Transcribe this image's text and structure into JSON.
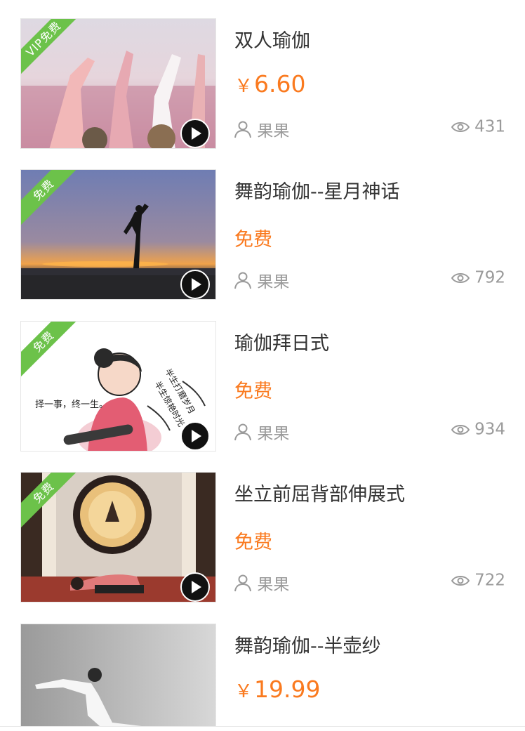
{
  "items": [
    {
      "title": "双人瑜伽",
      "badge": "VIP免费",
      "price": "6.60",
      "currency": "￥",
      "author": "果果",
      "views": "431",
      "icon_author": "user-icon",
      "icon_views": "eye-icon"
    },
    {
      "title": "舞韵瑜伽--星月神话",
      "badge": "免费",
      "price": "免费",
      "author": "果果",
      "views": "792"
    },
    {
      "title": "瑜伽拜日式",
      "badge": "免费",
      "price": "免费",
      "author": "果果",
      "views": "934",
      "thumb_text": {
        "left": "择一事，终一生。",
        "right_1": "半生打磨岁月",
        "right_2": "半生惊艳时光"
      }
    },
    {
      "title": "坐立前屈背部伸展式",
      "badge": "免费",
      "price": "免费",
      "author": "果果",
      "views": "722"
    },
    {
      "title": "舞韵瑜伽--半壶纱",
      "price": "19.99",
      "currency": "￥"
    }
  ],
  "colors": {
    "accent": "#fa7a1f",
    "badge": "#6cc24a",
    "text": "#333333",
    "muted": "#9a9a9a"
  }
}
